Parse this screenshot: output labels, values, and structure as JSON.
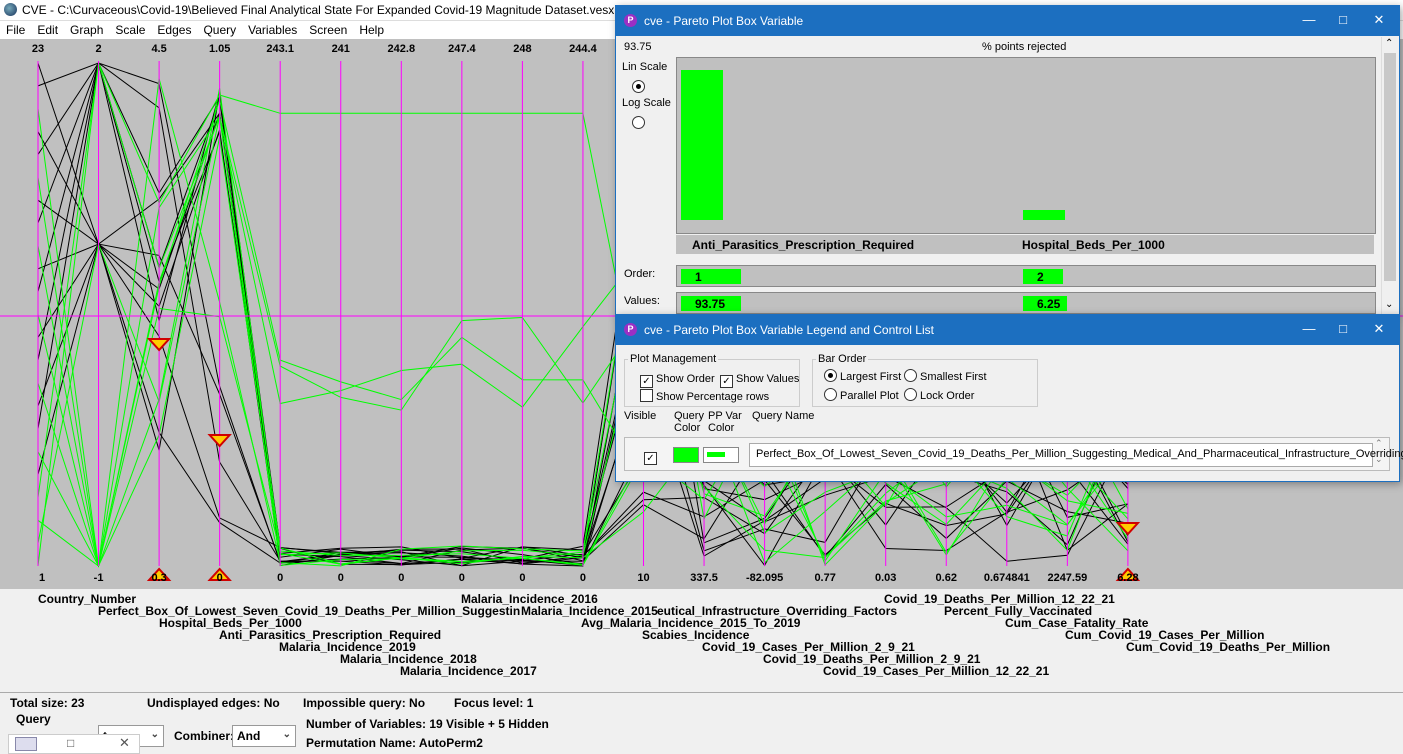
{
  "main": {
    "title": "CVE - C:\\Curvaceous\\Covid-19\\Believed Final Analytical State For Expanded Covid-19 Magnitude Dataset.vesx.csv",
    "menu": [
      "File",
      "Edit",
      "Graph",
      "Scale",
      "Edges",
      "Query",
      "Variables",
      "Screen",
      "Help"
    ],
    "axes_top": [
      "23",
      "2",
      "4.5",
      "1.05",
      "243.1",
      "241",
      "242.8",
      "247.4",
      "248",
      "244.4"
    ],
    "axes_bottom": [
      "1",
      "-1",
      "0.3",
      "0",
      "0",
      "0",
      "0",
      "0",
      "0",
      "0",
      "10",
      "337.5",
      "-82.095",
      "0.77",
      "0.03",
      "0.62",
      "0.674841",
      "2247.59",
      "6.28"
    ],
    "variable_labels": [
      "Country_Number",
      "Perfect_Box_Of_Lowest_Seven_Covid_19_Deaths_Per_Million_Suggestin",
      "Hospital_Beds_Per_1000",
      "Anti_Parasitics_Prescription_Required",
      "Malaria_Incidence_2019",
      "Malaria_Incidence_2018",
      "Malaria_Incidence_2017",
      "Malaria_Incidence_2016",
      "Malaria_Incidence_2015",
      "eutical_Infrastructure_Overriding_Factors",
      "Avg_Malaria_Incidence_2015_To_2019",
      "Scabies_Incidence",
      "Covid_19_Cases_Per_Million_2_9_21",
      "Covid_19_Deaths_Per_Million_2_9_21",
      "Covid_19_Cases_Per_Million_12_22_21",
      "Covid_19_Deaths_Per_Million_12_22_21",
      "Percent_Fully_Vaccinated",
      "Cum_Case_Fatality_Rate",
      "Cum_Covid_19_Cases_Per_Million",
      "Cum_Covid_19_Deaths_Per_Million"
    ],
    "status": {
      "total_size": "Total size: 23",
      "undisplayed_edges": "Undisplayed edges: No",
      "impossible_query": "Impossible query: No",
      "focus_level": "Focus level: 1",
      "query_label": "Query",
      "query_combo": "t",
      "combiner_label": "Combiner:",
      "combiner_value": "And",
      "num_vars": "Number of Variables:  19 Visible + 5 Hidden",
      "perm_name": "Permutation Name:    AutoPerm2"
    },
    "colors": {
      "axis": "#ff00ff",
      "selected": "#00ff00",
      "unselected": "#000000",
      "plot_bg": "#c0c0c0"
    }
  },
  "pareto": {
    "title": "cve - Pareto Plot Box Variable",
    "max_label": "93.75",
    "chart_title": "% points rejected",
    "lin_scale": "Lin Scale",
    "log_scale": "Log Scale",
    "order_label": "Order:",
    "values_label": "Values:",
    "chart_data": {
      "type": "bar",
      "title": "% points rejected",
      "categories": [
        "Anti_Parasitics_Prescription_Required",
        "Hospital_Beds_Per_1000"
      ],
      "values": [
        93.75,
        6.25
      ],
      "order": [
        "1",
        "2"
      ],
      "value_labels": [
        "93.75",
        "6.25"
      ],
      "ylim": [
        0,
        93.75
      ],
      "bar_color": "#00ff00"
    }
  },
  "legend": {
    "title": "cve - Pareto Plot Box Variable  Legend and Control List",
    "plot_management": "Plot Management",
    "show_order": "Show Order",
    "show_values": "Show Values",
    "show_percentage_rows": "Show Percentage rows",
    "bar_order": "Bar Order",
    "largest_first": "Largest First",
    "smallest_first": "Smallest First",
    "parallel_plot": "Parallel Plot",
    "lock_order": "Lock Order",
    "col_visible": "Visible",
    "col_query_color_1": "Query",
    "col_query_color_2": "Color",
    "col_ppvar_color_1": "PP Var",
    "col_ppvar_color_2": "Color",
    "col_query_name": "Query Name",
    "query_name": "Perfect_Box_Of_Lowest_Seven_Covid_19_Deaths_Per_Million_Suggesting_Medical_And_Pharmaceutical_Infrastructure_Overriding_Factors"
  }
}
